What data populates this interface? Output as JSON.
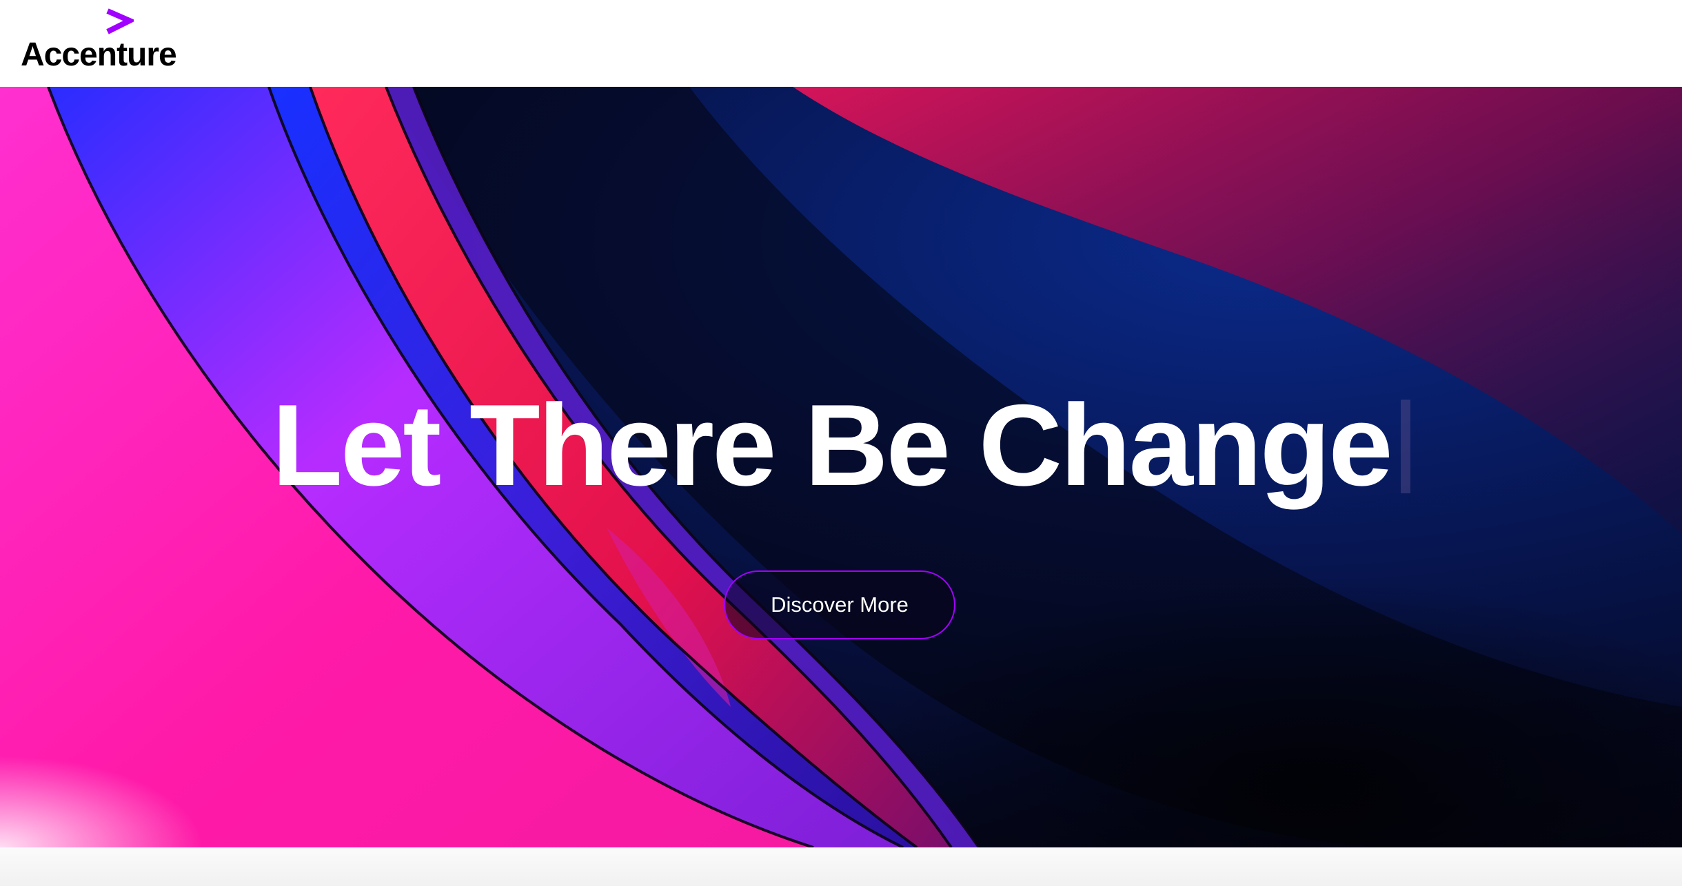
{
  "header": {
    "logo_text": "Accenture",
    "logo_icon": "accenture-chevron-icon",
    "brand_color": "#a100ff"
  },
  "hero": {
    "headline": "Let There Be Change",
    "cta_label": "Discover More",
    "cta_border_color": "#a100ff"
  }
}
